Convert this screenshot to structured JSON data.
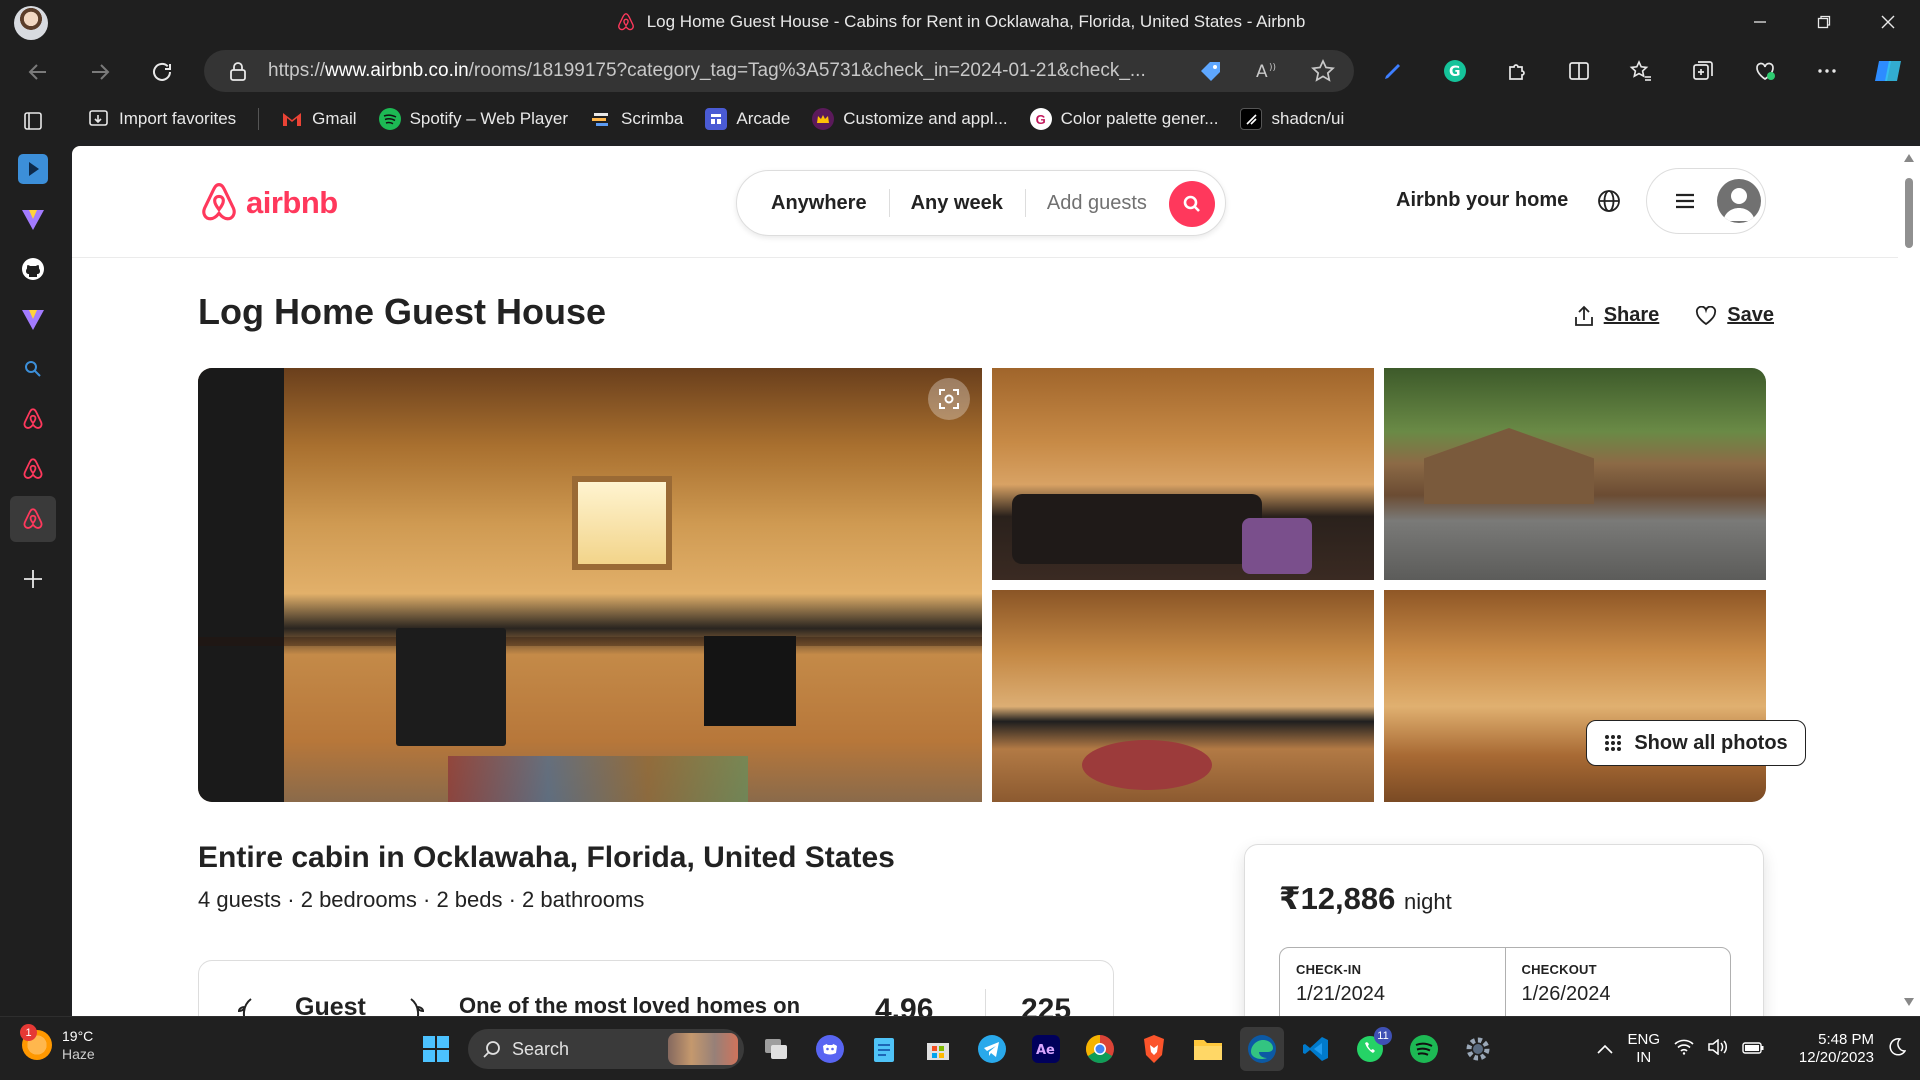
{
  "window": {
    "title": "Log Home Guest House - Cabins for Rent in Ocklawaha, Florida, United States - Airbnb"
  },
  "browser": {
    "url_prefix": "https://",
    "url_host": "www.airbnb.co.in",
    "url_rest": "/rooms/18199175?category_tag=Tag%3A5731&check_in=2024-01-21&check_..."
  },
  "bookmarks": [
    {
      "label": "Import favorites",
      "icon": "import-icon"
    },
    {
      "label": "Gmail",
      "icon": "gmail-icon"
    },
    {
      "label": "Spotify – Web Player",
      "icon": "spotify-icon"
    },
    {
      "label": "Scrimba",
      "icon": "scrimba-icon"
    },
    {
      "label": "Arcade",
      "icon": "arcade-icon"
    },
    {
      "label": "Customize and appl...",
      "icon": "crown-icon"
    },
    {
      "label": "Color palette gener...",
      "icon": "g-icon"
    },
    {
      "label": "shadcn/ui",
      "icon": "shadcn-icon"
    }
  ],
  "airbnb": {
    "logo_text": "airbnb",
    "brand_color": "#FF385C",
    "search": {
      "where": "Anywhere",
      "when": "Any week",
      "guests_placeholder": "Add guests"
    },
    "host_link": "Airbnb your home"
  },
  "listing": {
    "title": "Log Home Guest House",
    "share": "Share",
    "save": "Save",
    "show_all_photos": "Show all photos",
    "subtitle": "Entire cabin in Ocklawaha, Florida, United States",
    "facts": "4 guests · 2 bedrooms · 2 beds · 2 bathrooms",
    "highlight": {
      "guest": "Guest",
      "loved": "One of the most loved homes on",
      "rating": "4.96",
      "reviews": "225"
    },
    "booking": {
      "price": "₹12,886",
      "per": "night",
      "checkin_label": "CHECK-IN",
      "checkin_value": "1/21/2024",
      "checkout_label": "CHECKOUT",
      "checkout_value": "1/26/2024"
    }
  },
  "taskbar": {
    "weather_temp": "19°C",
    "weather_desc": "Haze",
    "weather_badge": "1",
    "search_label": "Search",
    "whatsapp_badge": "11",
    "lang_top": "ENG",
    "lang_bottom": "IN",
    "time": "5:48 PM",
    "date": "12/20/2023"
  }
}
